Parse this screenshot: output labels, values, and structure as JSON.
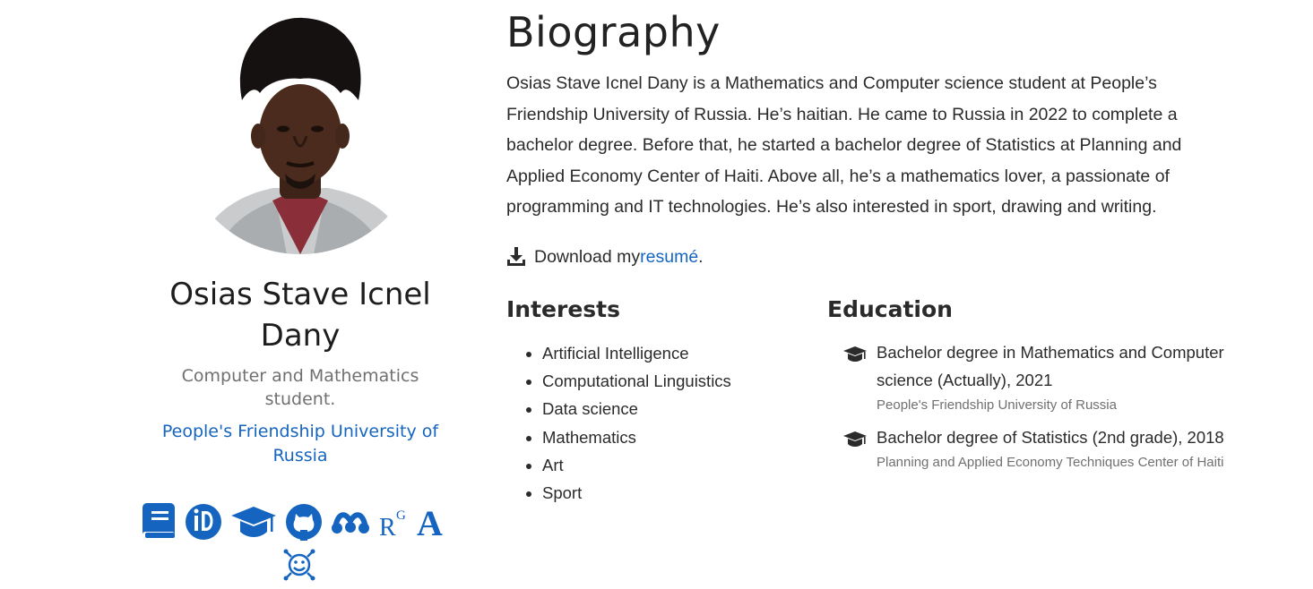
{
  "profile": {
    "name": "Osias Stave Icnel Dany",
    "role": "Computer and Mathematics student.",
    "organization": "People's Friendship University of Russia"
  },
  "social_icons": [
    "book-icon",
    "orcid-icon",
    "graduation-cap-icon",
    "github-icon",
    "mendeley-icon",
    "researchgate-icon",
    "academia-icon",
    "scilab-icon"
  ],
  "biography": {
    "heading": "Biography",
    "text": "Osias Stave Icnel Dany is a Mathematics and Computer science student at People’s Friendship University of Russia. He’s haitian. He came to Russia in 2022 to complete a bachelor degree. Before that, he started a bachelor degree of Statistics at Planning and Applied Economy Center of Haiti. Above all, he’s a mathematics lover, a passionate of programming and IT technologies. He’s also interested in sport, drawing and writing.",
    "download_prefix": "Download my ",
    "download_link": "resumé",
    "download_suffix": "."
  },
  "interests": {
    "title": "Interests",
    "items": [
      "Artificial Intelligence",
      "Computational Linguistics",
      "Data science",
      "Mathematics",
      "Art",
      "Sport"
    ]
  },
  "education": {
    "title": "Education",
    "items": [
      {
        "course": "Bachelor degree in Mathematics and Computer science (Actually), 2021",
        "institution": "People's Friendship University of Russia"
      },
      {
        "course": "Bachelor degree of Statistics (2nd grade), 2018",
        "institution": "Planning and Applied Economy Techniques Center of Haiti"
      }
    ]
  },
  "colors": {
    "accent": "#1565c0",
    "text": "#2b2b2b",
    "muted": "#707070"
  }
}
